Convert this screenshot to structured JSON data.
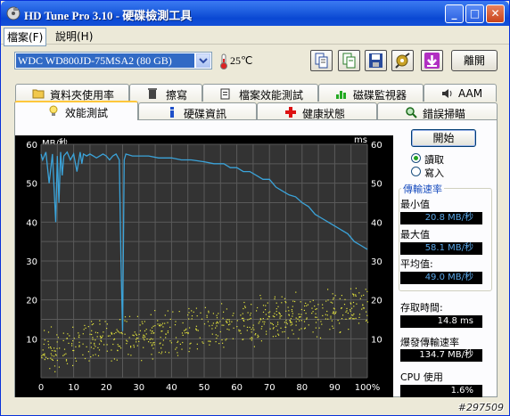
{
  "window": {
    "title": "HD Tune Pro 3.10 - 硬碟檢測工具"
  },
  "menu": [
    {
      "label": "檔案(F)"
    },
    {
      "label": "說明(H)"
    }
  ],
  "toolbar": {
    "drive": "WDC WD800JD-75MSA2 (80 GB)",
    "temperature": "25℃",
    "exit_label": "離開"
  },
  "tabs_top": [
    {
      "label": "資料夾使用率",
      "icon": "folder-icon"
    },
    {
      "label": "擦寫",
      "icon": "trash-icon"
    },
    {
      "label": "檔案效能測試",
      "icon": "file-benchmark-icon"
    },
    {
      "label": "磁碟監視器",
      "icon": "disk-monitor-icon"
    },
    {
      "label": "AAM",
      "icon": "speaker-icon"
    }
  ],
  "tabs_bottom": [
    {
      "label": "效能測試",
      "icon": "benchmark-icon"
    },
    {
      "label": "硬碟資訊",
      "icon": "info-icon"
    },
    {
      "label": "健康狀態",
      "icon": "health-icon"
    },
    {
      "label": "錯誤掃瞄",
      "icon": "error-scan-icon"
    }
  ],
  "controls": {
    "start_label": "開始",
    "read_label": "讀取",
    "write_label": "寫入",
    "mode": "read"
  },
  "stats": {
    "group_title": "傳輸速率",
    "min_label": "最小值",
    "min_value": "20.8 MB/秒",
    "max_label": "最大值",
    "max_value": "58.1 MB/秒",
    "avg_label": "平均值:",
    "avg_value": "49.0 MB/秒",
    "access_label": "存取時間:",
    "access_value": "14.8 ms",
    "burst_label": "爆發傳輸速率",
    "burst_value": "134.7 MB/秒",
    "cpu_label": "CPU 使用",
    "cpu_value": "1.6%"
  },
  "watermark": "#297509",
  "colors": {
    "transfer_line": "#3ba3d9",
    "access_dots": "#e6e63c",
    "chart_bg": "#333333",
    "grid": "#5a5a5a"
  },
  "chart_data": {
    "type": "line",
    "ylabel_left": "MB/秒",
    "ylabel_right": "ms",
    "ylim": [
      0,
      60
    ],
    "xlim": [
      0,
      100
    ],
    "y_ticks": [
      10,
      20,
      30,
      40,
      50,
      60
    ],
    "x_ticks": [
      "0",
      "10",
      "20",
      "30",
      "40",
      "50",
      "60",
      "70",
      "80",
      "90",
      "100%"
    ],
    "grid": true,
    "series": [
      {
        "name": "",
        "x": [
          0,
          0.5,
          1.5,
          2.5,
          3.5,
          4.5,
          5,
          5.5,
          6,
          6.5,
          7,
          8,
          9,
          10,
          11,
          12,
          12.5,
          13,
          14,
          15,
          16,
          17,
          18,
          19,
          20,
          21,
          22,
          23,
          24,
          24.5,
          25,
          25.5,
          26,
          28,
          30,
          33,
          36,
          40,
          43,
          46,
          50,
          53,
          56,
          58,
          60,
          62,
          64,
          66,
          68,
          70,
          72,
          74,
          76,
          78,
          80,
          82,
          84,
          86,
          88,
          90,
          92,
          94,
          96,
          98,
          100
        ],
        "y": [
          57.5,
          56,
          58,
          50,
          57.5,
          40,
          57,
          45,
          58,
          52,
          57,
          58,
          56,
          57.5,
          53,
          58,
          55,
          57.5,
          57,
          57.5,
          57,
          56.5,
          57,
          57.5,
          57,
          56,
          57,
          57.5,
          56,
          30,
          12,
          56,
          57.5,
          57,
          57,
          57,
          56.5,
          56.5,
          56,
          56,
          55.5,
          55,
          55,
          54,
          54,
          53,
          53,
          52,
          51,
          51,
          49,
          48,
          47,
          46.5,
          45,
          44,
          42,
          41,
          40,
          39,
          38,
          37,
          35,
          34,
          33
        ]
      }
    ],
    "scatter": {
      "name": "",
      "y_range": [
        3,
        22
      ],
      "count": 650
    }
  }
}
